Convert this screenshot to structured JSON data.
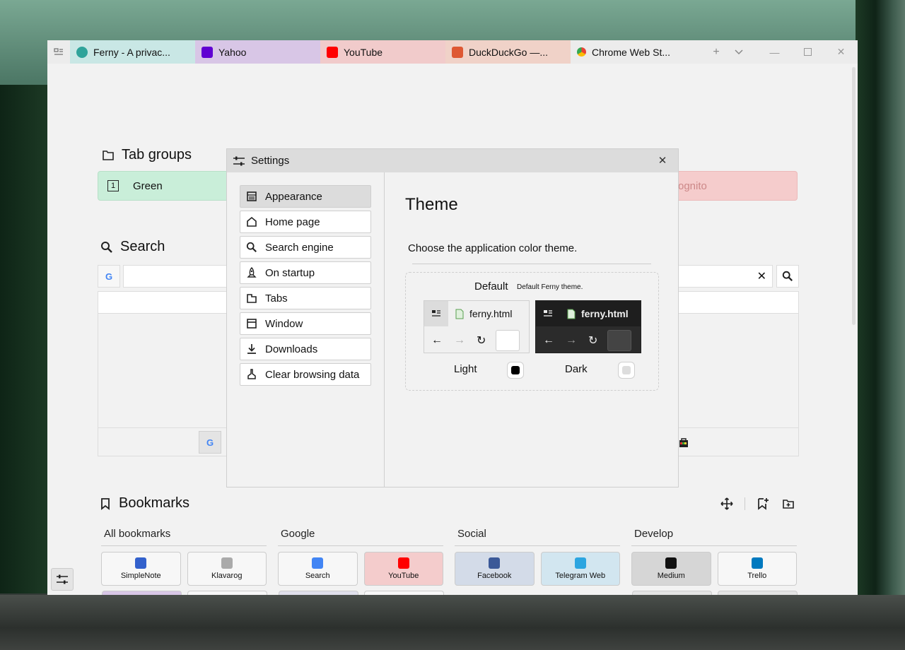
{
  "tabs": [
    {
      "title": "Ferny - A privac...",
      "bg": "#c9e7e5",
      "icon": "ferny-icon",
      "icon_color": "#2fa39a"
    },
    {
      "title": "Yahoo",
      "bg": "#d8c6e6",
      "icon": "yahoo-icon",
      "icon_color": "#6001d2"
    },
    {
      "title": "YouTube",
      "bg": "#f1cbcb",
      "icon": "youtube-icon",
      "icon_color": "#ff0000"
    },
    {
      "title": "DuckDuckGo —...",
      "bg": "#f0d2c8",
      "icon": "duckduckgo-icon",
      "icon_color": "#de5833"
    },
    {
      "title": "Chrome Web St...",
      "bg": "#ececec",
      "icon": "chrome-icon",
      "icon_color": "#4285f4"
    }
  ],
  "tab_groups": {
    "title": "Tab groups",
    "green": {
      "number": "1",
      "label": "Green"
    },
    "incognito_fragment": "ognito"
  },
  "search": {
    "title": "Search",
    "engine_letter": "G",
    "clear_symbol": "✕"
  },
  "bookmarks": {
    "title": "Bookmarks",
    "columns": [
      {
        "title": "All bookmarks",
        "items": [
          {
            "label": "SimpleNote",
            "icon": "simplenote-icon",
            "icon_color": "#3361cc",
            "bg": "#f7f7f7"
          },
          {
            "label": "Klavarog",
            "icon": "klavarog-icon",
            "icon_color": "#aaaaaa",
            "bg": "#f7f7f7"
          }
        ]
      },
      {
        "title": "Google",
        "items": [
          {
            "label": "Search",
            "icon": "google-icon",
            "icon_color": "#4285f4",
            "bg": "#f7f7f7"
          },
          {
            "label": "YouTube",
            "icon": "youtube-icon",
            "icon_color": "#ff0000",
            "bg": "#f4cccc"
          }
        ]
      },
      {
        "title": "Social",
        "items": [
          {
            "label": "Facebook",
            "icon": "facebook-icon",
            "icon_color": "#3b5998",
            "bg": "#d3dbe8"
          },
          {
            "label": "Telegram Web",
            "icon": "telegram-icon",
            "icon_color": "#2ca5e0",
            "bg": "#d2e6f0"
          }
        ]
      },
      {
        "title": "Develop",
        "items": [
          {
            "label": "Medium",
            "icon": "medium-icon",
            "icon_color": "#111111",
            "bg": "#d6d6d6"
          },
          {
            "label": "Trello",
            "icon": "trello-icon",
            "icon_color": "#0079bf",
            "bg": "#f7f7f7"
          }
        ]
      }
    ]
  },
  "settings": {
    "title": "Settings",
    "nav": [
      {
        "label": "Appearance",
        "icon": "appearance-icon",
        "active": true
      },
      {
        "label": "Home page",
        "icon": "home-icon",
        "active": false
      },
      {
        "label": "Search engine",
        "icon": "search-icon",
        "active": false
      },
      {
        "label": "On startup",
        "icon": "rocket-icon",
        "active": false
      },
      {
        "label": "Tabs",
        "icon": "tab-icon",
        "active": false
      },
      {
        "label": "Window",
        "icon": "window-icon",
        "active": false
      },
      {
        "label": "Downloads",
        "icon": "download-icon",
        "active": false
      },
      {
        "label": "Clear browsing data",
        "icon": "broom-icon",
        "active": false
      }
    ],
    "theme": {
      "title": "Theme",
      "description": "Choose the application color theme.",
      "default_label": "Default",
      "default_sub": "Default Ferny theme.",
      "preview_file": "ferny.html",
      "light_label": "Light",
      "dark_label": "Dark",
      "selected": "Light"
    }
  }
}
